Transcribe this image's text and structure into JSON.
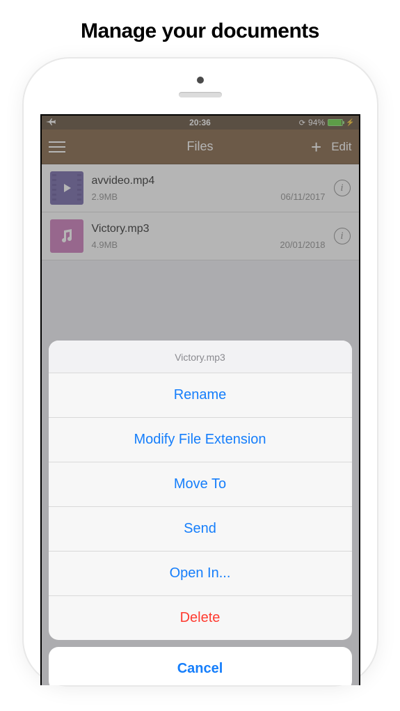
{
  "promo_title": "Manage your documents",
  "status": {
    "time": "20:36",
    "battery_pct": "94%"
  },
  "nav": {
    "title": "Files",
    "edit": "Edit"
  },
  "files": [
    {
      "name": "avvideo.mp4",
      "size": "2.9MB",
      "date": "06/11/2017",
      "kind": "video"
    },
    {
      "name": "Victory.mp3",
      "size": "4.9MB",
      "date": "20/01/2018",
      "kind": "audio"
    }
  ],
  "action_sheet": {
    "title": "Victory.mp3",
    "items": [
      {
        "label": "Rename"
      },
      {
        "label": "Modify File Extension"
      },
      {
        "label": "Move To"
      },
      {
        "label": "Send"
      },
      {
        "label": "Open In..."
      },
      {
        "label": "Delete",
        "destructive": true
      }
    ],
    "cancel": "Cancel"
  }
}
